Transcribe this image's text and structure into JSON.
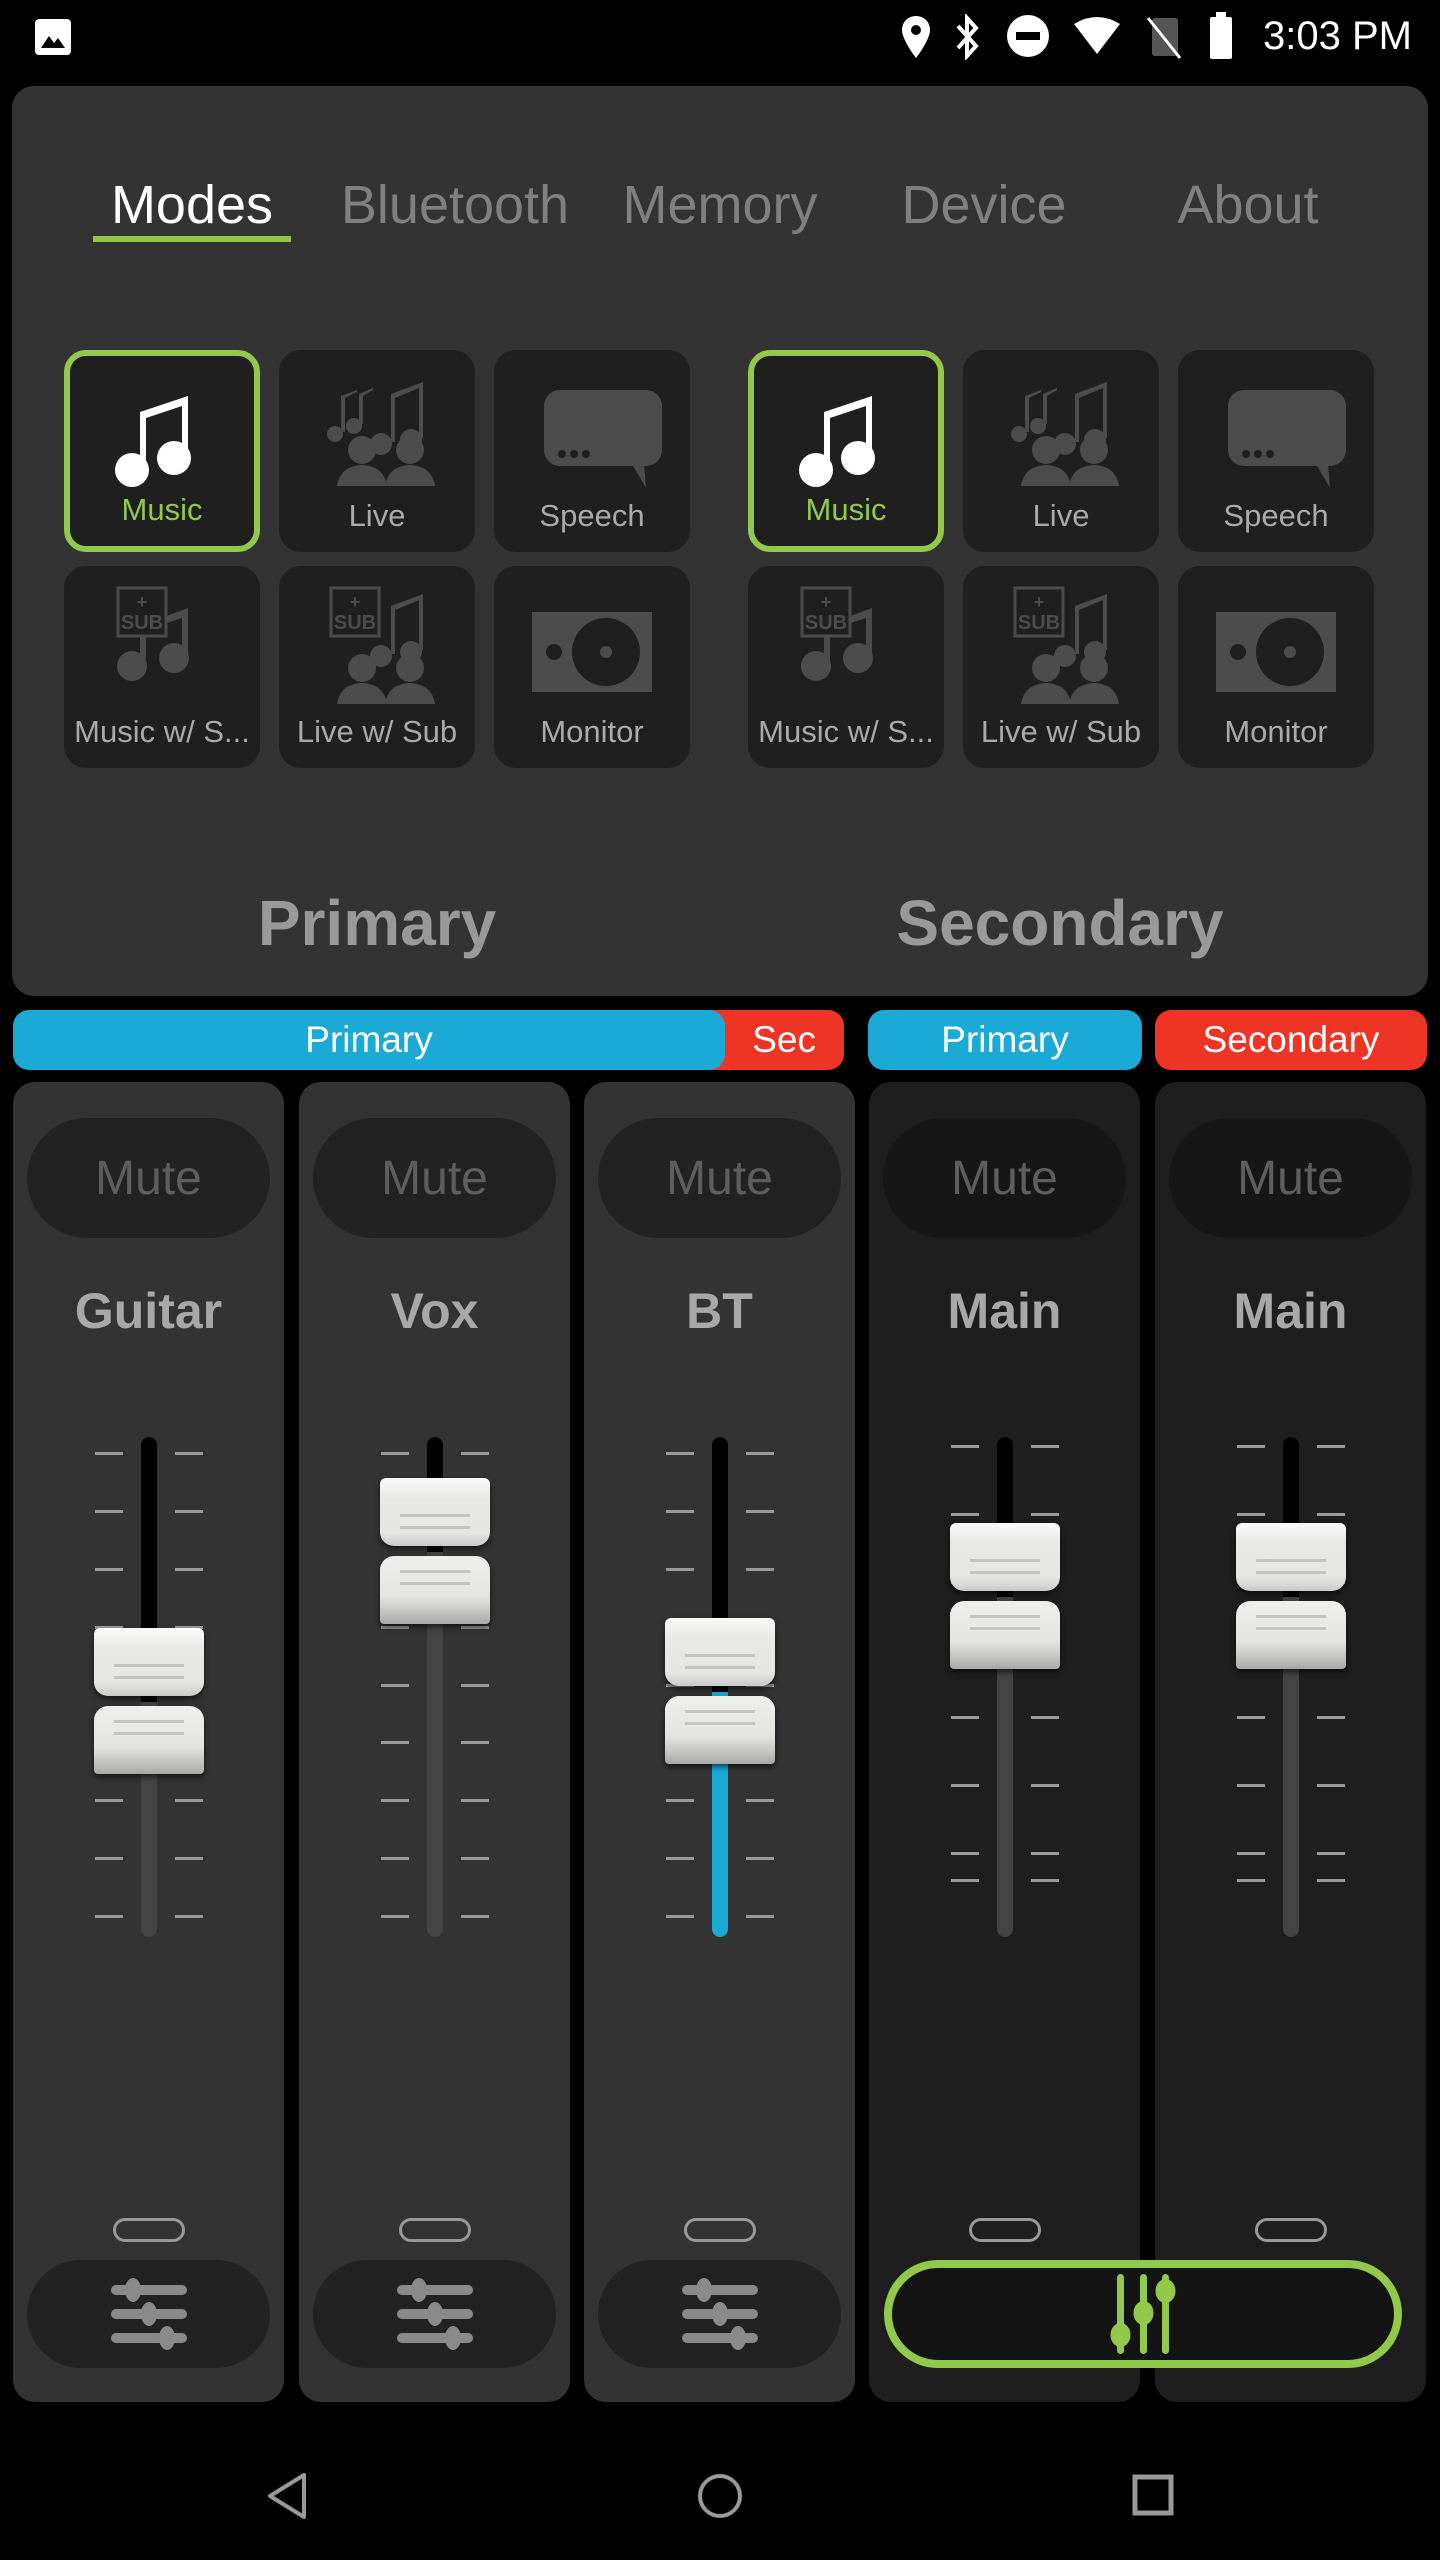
{
  "status_bar": {
    "time": "3:03 PM",
    "icons": [
      "image-notification-icon",
      "location-icon",
      "bluetooth-icon",
      "do-not-disturb-icon",
      "wifi-icon",
      "no-sim-icon",
      "battery-icon"
    ]
  },
  "tabs": [
    {
      "label": "Modes",
      "active": true
    },
    {
      "label": "Bluetooth",
      "active": false
    },
    {
      "label": "Memory",
      "active": false
    },
    {
      "label": "Device",
      "active": false
    },
    {
      "label": "About",
      "active": false
    }
  ],
  "mode_groups": [
    {
      "label": "Primary",
      "selected": "Music",
      "modes": [
        {
          "label": "Music",
          "icon": "music-note-icon",
          "selected": true
        },
        {
          "label": "Live",
          "icon": "live-audience-icon",
          "selected": false
        },
        {
          "label": "Speech",
          "icon": "speech-bubble-icon",
          "selected": false
        },
        {
          "label": "Music w/ S...",
          "icon": "music-sub-icon",
          "selected": false
        },
        {
          "label": "Live w/ Sub",
          "icon": "live-sub-icon",
          "selected": false
        },
        {
          "label": "Monitor",
          "icon": "monitor-speaker-icon",
          "selected": false
        }
      ]
    },
    {
      "label": "Secondary",
      "selected": "Music",
      "modes": [
        {
          "label": "Music",
          "icon": "music-note-icon",
          "selected": true
        },
        {
          "label": "Live",
          "icon": "live-audience-icon",
          "selected": false
        },
        {
          "label": "Speech",
          "icon": "speech-bubble-icon",
          "selected": false
        },
        {
          "label": "Music w/ S...",
          "icon": "music-sub-icon",
          "selected": false
        },
        {
          "label": "Live w/ Sub",
          "icon": "live-sub-icon",
          "selected": false
        },
        {
          "label": "Monitor",
          "icon": "monitor-speaker-icon",
          "selected": false
        }
      ]
    }
  ],
  "bus_bar": {
    "input_primary": "Primary",
    "input_secondary": "Sec",
    "out_primary": "Primary",
    "out_secondary": "Secondary"
  },
  "channels": [
    {
      "name": "Guitar",
      "mute_label": "Mute",
      "muted": false,
      "level": 0.47,
      "fill_color": null,
      "dark": false
    },
    {
      "name": "Vox",
      "mute_label": "Mute",
      "muted": false,
      "level": 0.77,
      "fill_color": null,
      "dark": false
    },
    {
      "name": "BT",
      "mute_label": "Mute",
      "muted": false,
      "level": 0.49,
      "fill_color": "#1ba9d6",
      "dark": false
    },
    {
      "name": "Main",
      "mute_label": "Mute",
      "muted": false,
      "level": 0.68,
      "fill_color": null,
      "dark": true
    },
    {
      "name": "Main",
      "mute_label": "Mute",
      "muted": false,
      "level": 0.68,
      "fill_color": null,
      "dark": true
    }
  ],
  "colors": {
    "accent_green": "#92c94a",
    "primary_blue": "#1ba9d6",
    "secondary_red": "#ee3424",
    "panel": "#333333"
  },
  "nav_bar": [
    "back-icon",
    "home-icon",
    "recents-icon"
  ]
}
